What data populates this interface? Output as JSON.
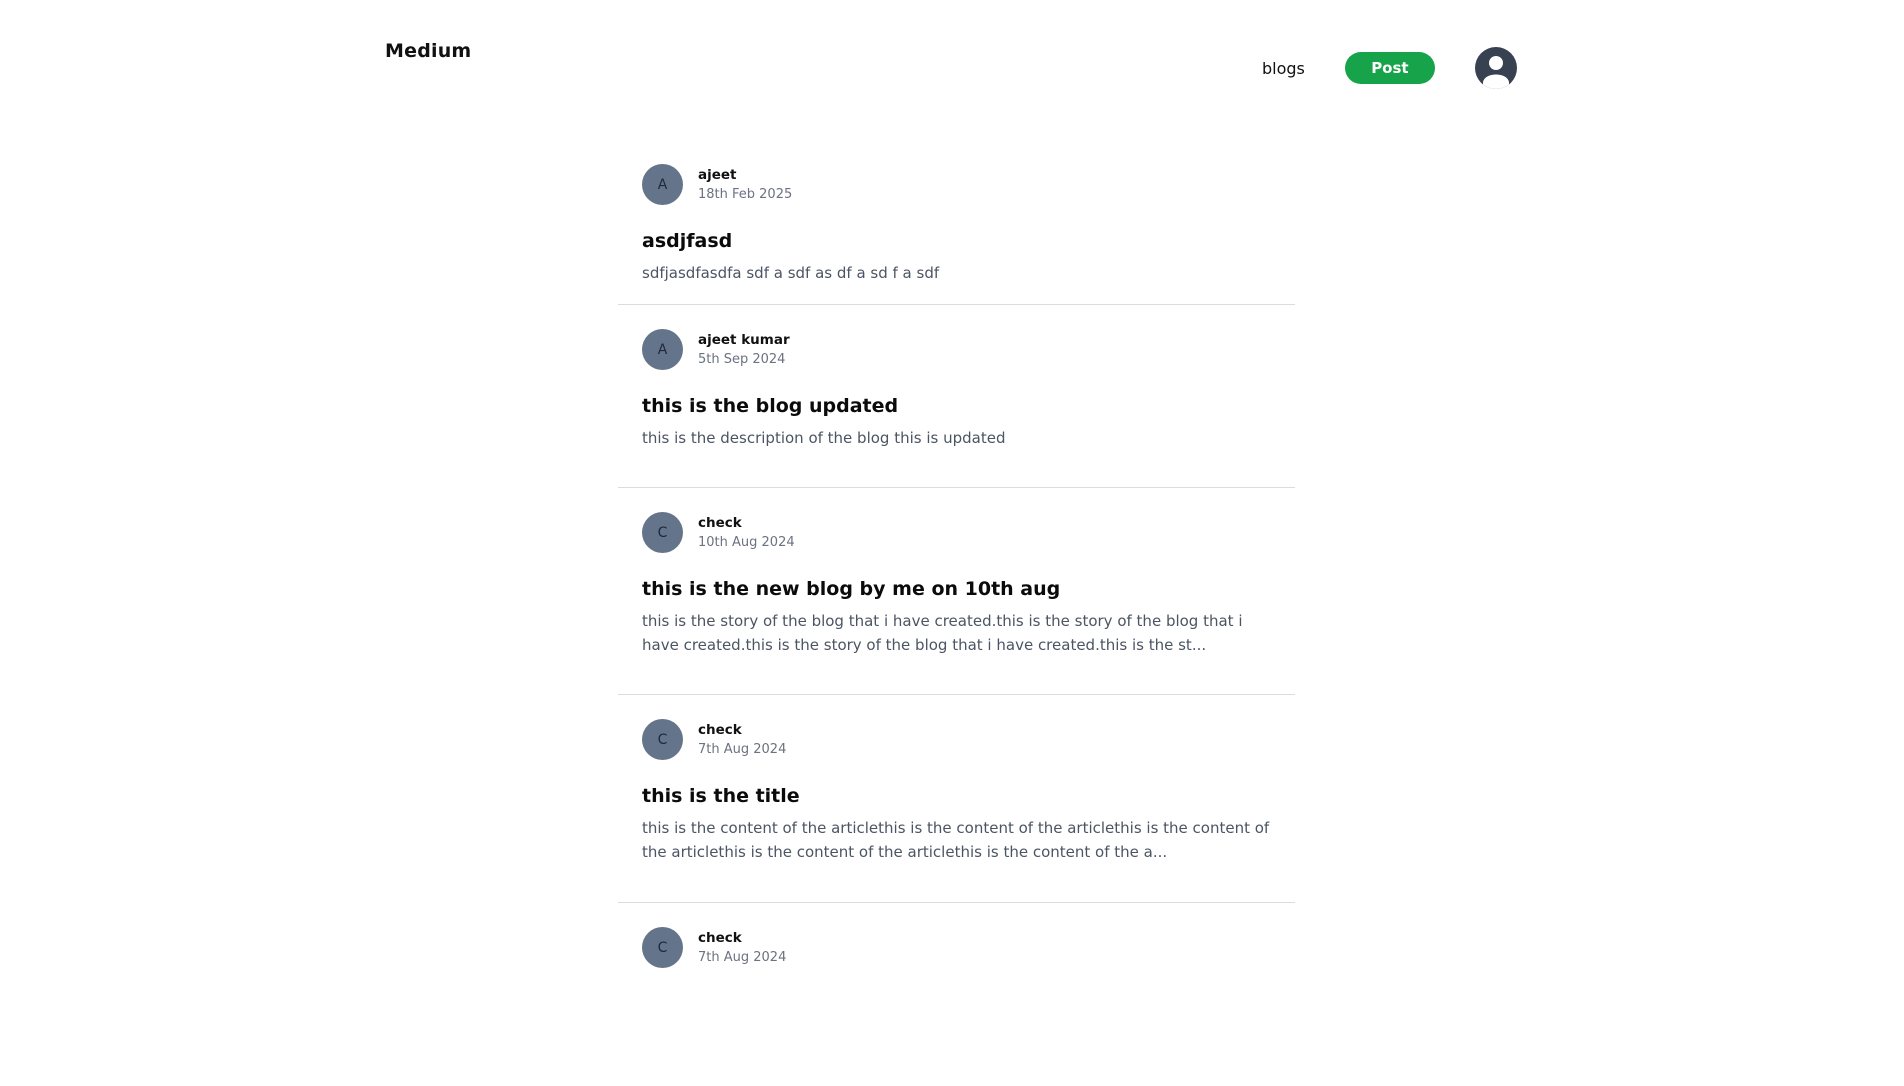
{
  "header": {
    "brand": "Medium",
    "nav_blogs": "blogs",
    "post_label": "Post"
  },
  "blogs": [
    {
      "initial": "A",
      "author": "ajeet",
      "date": "18th Feb 2025",
      "title": "asdjfasd",
      "description": "sdfjasdfasdfa sdf a sdf as df a sd f a sdf"
    },
    {
      "initial": "A",
      "author": "ajeet kumar",
      "date": "5th Sep 2024",
      "title": "this is the blog updated",
      "description": "this is the description of the blog this is updated"
    },
    {
      "initial": "C",
      "author": "check",
      "date": "10th Aug 2024",
      "title": "this is the new blog by me on 10th aug",
      "description": "this is the story of the blog that i have created.this is the story of the blog that i have created.this is the story of the blog that i have created.this is the st..."
    },
    {
      "initial": "C",
      "author": "check",
      "date": "7th Aug 2024",
      "title": "this is the title",
      "description": "this is the content of the articlethis is the content of the articlethis is the content of the articlethis is the content of the articlethis is the content of the a..."
    },
    {
      "initial": "C",
      "author": "check",
      "date": "7th Aug 2024",
      "title": "",
      "description": ""
    }
  ],
  "colors": {
    "accent": "#16a34a",
    "avatar": "#64748b",
    "profile": "#374151",
    "divider": "#d9dde3"
  }
}
